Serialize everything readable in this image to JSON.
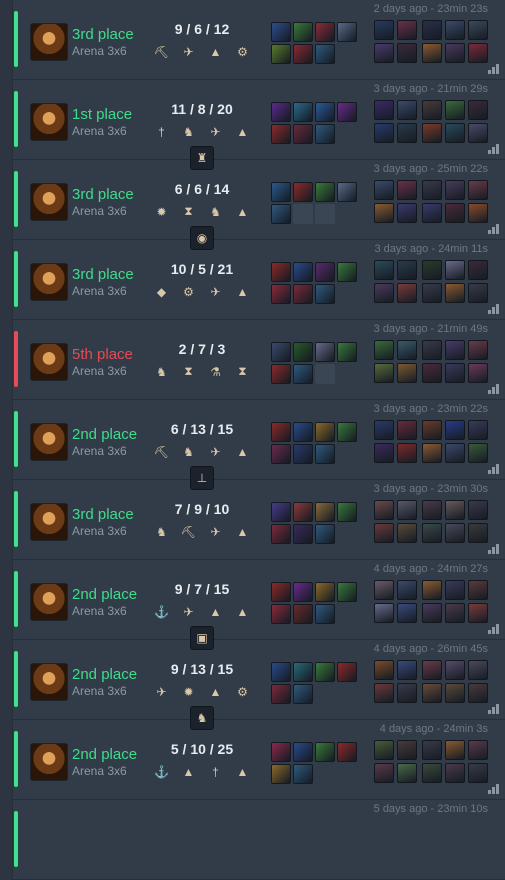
{
  "colors": {
    "win": "#3fe28f",
    "loss": "#ea4b57",
    "win_text": "#3fdc8a",
    "loss_text": "#e84a55"
  },
  "matches": [
    {
      "placement": "3rd place",
      "result": "win",
      "mode": "Arena 3x6",
      "kda": "9 / 6 / 12",
      "time": "2 days ago - 23min 23s",
      "augments": [
        "shovel-icon",
        "wing-icon",
        "stack-icon",
        "gear-icon"
      ],
      "augments_boxed": [],
      "items": [
        "#2e4e8c",
        "#3b7a3a",
        "#8c2b3a",
        "#5a6a8a",
        "#5b7a2a",
        "#8a2830",
        "#2f5a80"
      ],
      "team_a": [
        "#283a60",
        "#6a3048",
        "#4a3a6a",
        "#3a2a3a"
      ],
      "team_b": [
        "#2a2e4a",
        "#3a4a6a",
        "#3a4a5a",
        "#8a5a30",
        "#4a3a5a",
        "#7a2a3a"
      ]
    },
    {
      "placement": "1st place",
      "result": "win",
      "mode": "Arena 3x6",
      "kda": "11 / 8 / 20",
      "time": "3 days ago - 21min 29s",
      "augments": [
        "sword-icon",
        "boot-icon",
        "wing-icon",
        "stack-icon"
      ],
      "augments_boxed": [
        "figure-icon"
      ],
      "items": [
        "#5a2a8a",
        "#2a6a8a",
        "#2a5a9a",
        "#6a2a8a",
        "#8a2a2a",
        "#6a2a3a",
        "#2f5a80"
      ],
      "team_a": [
        "#3a2a6a",
        "#3a4a6a",
        "#2a3a6a",
        "#2a3a4a"
      ],
      "team_b": [
        "#4a3a3a",
        "#3a6a3a",
        "#3a2a3a",
        "#7a3a2a",
        "#2a4a5a",
        "#4a4a6a"
      ]
    },
    {
      "placement": "3rd place",
      "result": "win",
      "mode": "Arena 3x6",
      "kda": "6 / 6 / 14",
      "time": "3 days ago - 25min 22s",
      "augments": [
        "sun-icon",
        "hourglass-icon",
        "boot-icon",
        "stack-icon"
      ],
      "augments_boxed": [
        "orb-icon"
      ],
      "items": [
        "#2a5a8a",
        "#8a2a2a",
        "#3a7a3a",
        "#5a6a8a",
        "#2f5a80",
        "",
        ""
      ],
      "team_a": [
        "#3a4a6a",
        "#6a3048",
        "#8a5a30",
        "#3a3a6a"
      ],
      "team_b": [
        "#3a3a4a",
        "#4a3a5a",
        "#6a3a4a",
        "#3a3a6a",
        "#4a2a3a",
        "#8a4a2a"
      ]
    },
    {
      "placement": "3rd place",
      "result": "win",
      "mode": "Arena 3x6",
      "kda": "10 / 5 / 21",
      "time": "3 days ago - 24min 11s",
      "augments": [
        "diamond-icon",
        "gear-icon",
        "wing-icon",
        "stack-icon"
      ],
      "augments_boxed": [],
      "items": [
        "#8a2a2a",
        "#2a4a8a",
        "#5a2a6a",
        "#3a7a3a",
        "#8a2a3a",
        "#7a2a3a",
        "#2f5a80"
      ],
      "team_a": [
        "#2a4a5a",
        "#2a3a4a",
        "#4a3a5a",
        "#7a3a3a"
      ],
      "team_b": [
        "#2a3a2a",
        "#6a6a8a",
        "#3a2a3a",
        "#3a3a4a",
        "#8a5a30",
        "#3a3a4a"
      ]
    },
    {
      "placement": "5th place",
      "result": "loss",
      "mode": "Arena 3x6",
      "kda": "2 / 7 / 3",
      "time": "3 days ago - 21min 49s",
      "augments": [
        "boot-icon",
        "hourglass-icon",
        "potion-icon",
        "hourglass-icon"
      ],
      "augments_boxed": [],
      "items": [
        "#3a4a6a",
        "#2a5a2a",
        "#6a6a8a",
        "#3a7a3a",
        "#8a2a2a",
        "#2f5a80",
        ""
      ],
      "team_a": [
        "#3a6a3a",
        "#3a5a6a",
        "#5a6a3a",
        "#7a5a30"
      ],
      "team_b": [
        "#3a3a4a",
        "#4a3a6a",
        "#6a3a4a",
        "#4a2a3a",
        "#3a3a5a",
        "#6a3a5a"
      ]
    },
    {
      "placement": "2nd place",
      "result": "win",
      "mode": "Arena 3x6",
      "kda": "6 / 13 / 15",
      "time": "3 days ago - 23min 22s",
      "augments": [
        "shovel-icon",
        "boot-icon",
        "wing-icon",
        "stack-icon"
      ],
      "augments_boxed": [
        "anvil-icon"
      ],
      "items": [
        "#8a2a2a",
        "#2a4a8a",
        "#8a6a2a",
        "#3a7a3a",
        "#6a2a4a",
        "#2a3a6a",
        "#2f5a80"
      ],
      "team_a": [
        "#2a3a6a",
        "#6a2a3a",
        "#3a2a5a",
        "#7a2a2a"
      ],
      "team_b": [
        "#6a3a2a",
        "#2a3a8a",
        "#3a3a5a",
        "#8a5a30",
        "#3a4a6a",
        "#3a5a3a"
      ]
    },
    {
      "placement": "3rd place",
      "result": "win",
      "mode": "Arena 3x6",
      "kda": "7 / 9 / 10",
      "time": "3 days ago - 23min 30s",
      "augments": [
        "boot-icon",
        "shovel-icon",
        "wing-icon",
        "stack-icon"
      ],
      "augments_boxed": [],
      "items": [
        "#4a3a8a",
        "#8a3a3a",
        "#8a6a3a",
        "#3a7a3a",
        "#7a2a3a",
        "#3a2a5a",
        "#2f5a80"
      ],
      "team_a": [
        "#6a4a4a",
        "#5a5a6a",
        "#6a3a3a",
        "#5a4a3a"
      ],
      "team_b": [
        "#4a3a4a",
        "#6a5a5a",
        "#3a3a4a",
        "#3a4a4a",
        "#4a4a5a",
        "#3a3a3a"
      ]
    },
    {
      "placement": "2nd place",
      "result": "win",
      "mode": "Arena 3x6",
      "kda": "9 / 7 / 15",
      "time": "4 days ago - 24min 27s",
      "augments": [
        "anchor-icon",
        "wing-icon",
        "stack-icon",
        "stack-icon"
      ],
      "augments_boxed": [
        "chest-icon"
      ],
      "items": [
        "#8a2a2a",
        "#6a2a8a",
        "#8a6a2a",
        "#3a7a3a",
        "#8a2a3a",
        "#6a2a2a",
        "#2f5a80"
      ],
      "team_a": [
        "#6a5a6a",
        "#3a4a6a",
        "#6a6a8a",
        "#3a4a7a"
      ],
      "team_b": [
        "#8a5a30",
        "#3a3a5a",
        "#5a3a3a",
        "#4a3a5a",
        "#4a3a4a",
        "#7a3a3a"
      ]
    },
    {
      "placement": "2nd place",
      "result": "win",
      "mode": "Arena 3x6",
      "kda": "9 / 13 / 15",
      "time": "4 days ago - 26min 45s",
      "augments": [
        "wing-icon",
        "sun-icon",
        "stack-icon",
        "gear-icon"
      ],
      "augments_boxed": [
        "boot-icon"
      ],
      "items": [
        "#2a4a8a",
        "#2a6a7a",
        "#3a7a3a",
        "#8a2a2a",
        "#7a2a3a",
        "#2f5a80"
      ],
      "team_a": [
        "#7a4a2a",
        "#3a4a7a",
        "#6a3a3a",
        "#3a3a4a"
      ],
      "team_b": [
        "#6a3a4a",
        "#5a4a6a",
        "#4a4a5a",
        "#6a4a3a",
        "#5a4a3a",
        "#4a3a3a"
      ]
    },
    {
      "placement": "2nd place",
      "result": "win",
      "mode": "Arena 3x6",
      "kda": "5 / 10 / 25",
      "time": "4 days ago - 24min 3s",
      "augments": [
        "anchor-icon",
        "stack-icon",
        "sword-icon",
        "stack-icon"
      ],
      "augments_boxed": [],
      "items": [
        "#8a2a4a",
        "#2a4a8a",
        "#3a7a3a",
        "#8a2a2a",
        "#8a6a2a",
        "#2f5a80"
      ],
      "team_a": [
        "#4a5a3a",
        "#4a3a3a",
        "#5a3a4a",
        "#4a6a4a"
      ],
      "team_b": [
        "#3a3a4a",
        "#8a5a30",
        "#5a3a4a",
        "#3a4a3a",
        "#4a3a4a",
        "#3a3a4a"
      ]
    },
    {
      "placement": "",
      "result": "win",
      "mode": "",
      "kda": "",
      "time": "5 days ago - 23min 10s",
      "augments": [],
      "augments_boxed": [],
      "items": [],
      "team_a": [],
      "team_b": []
    }
  ]
}
